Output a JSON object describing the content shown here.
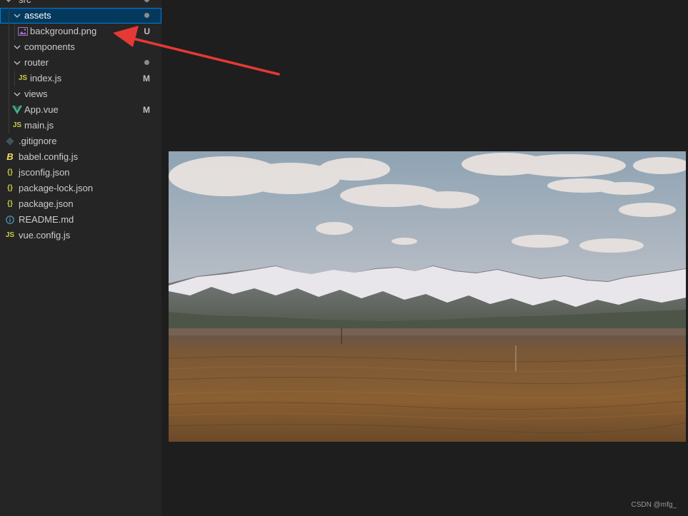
{
  "explorer": {
    "items": [
      {
        "label": "src",
        "decoration": "",
        "dot": true
      },
      {
        "label": "assets",
        "decoration": "",
        "dot": true,
        "selected": true
      },
      {
        "label": "background.png",
        "decoration": "U",
        "icon": "image-file-icon"
      },
      {
        "label": "components",
        "decoration": ""
      },
      {
        "label": "router",
        "decoration": "",
        "dot": true
      },
      {
        "label": "index.js",
        "decoration": "M",
        "icon": "js-file-icon"
      },
      {
        "label": "views",
        "decoration": ""
      },
      {
        "label": "App.vue",
        "decoration": "M",
        "icon": "vue-file-icon"
      },
      {
        "label": "main.js",
        "decoration": "",
        "icon": "js-file-icon"
      },
      {
        "label": ".gitignore",
        "decoration": "",
        "icon": "git-file-icon"
      },
      {
        "label": "babel.config.js",
        "decoration": "",
        "icon": "babel-file-icon"
      },
      {
        "label": "jsconfig.json",
        "decoration": "",
        "icon": "json-file-icon"
      },
      {
        "label": "package-lock.json",
        "decoration": "",
        "icon": "json-file-icon"
      },
      {
        "label": "package.json",
        "decoration": "",
        "icon": "json-file-icon"
      },
      {
        "label": "README.md",
        "decoration": "",
        "icon": "info-file-icon"
      },
      {
        "label": "vue.config.js",
        "decoration": "",
        "icon": "js-file-icon"
      }
    ],
    "icon_text": {
      "js": "JS",
      "json": "{}",
      "babel": "B",
      "info": "i"
    }
  },
  "watermark": "CSDN @mfg_",
  "colors": {
    "sidebar_bg": "#252526",
    "editor_bg": "#1e1e1e",
    "selection_bg": "#04395e",
    "selection_border": "#007fd4",
    "arrow": "#e53935"
  }
}
